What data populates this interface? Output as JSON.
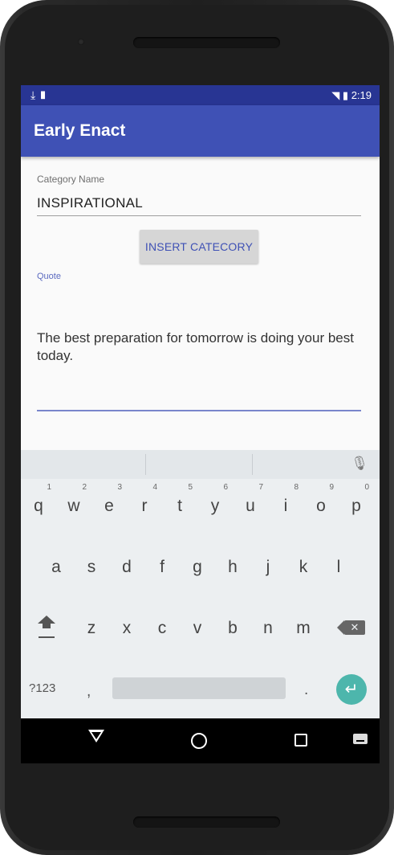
{
  "status_bar": {
    "left_icons": "⤓ ▮",
    "right_icons": "◥ ▮",
    "time": "2:19"
  },
  "app_bar": {
    "title": "Early Enact"
  },
  "form": {
    "category_label": "Category Name",
    "category_value": "INSPIRATIONAL",
    "insert_button_label": "INSERT CATECORY",
    "quote_label": "Quote",
    "quote_value": "The best preparation for tomorrow is doing your best today."
  },
  "keyboard": {
    "row1": [
      {
        "label": "q",
        "hint": "1"
      },
      {
        "label": "w",
        "hint": "2"
      },
      {
        "label": "e",
        "hint": "3"
      },
      {
        "label": "r",
        "hint": "4"
      },
      {
        "label": "t",
        "hint": "5"
      },
      {
        "label": "y",
        "hint": "6"
      },
      {
        "label": "u",
        "hint": "7"
      },
      {
        "label": "i",
        "hint": "8"
      },
      {
        "label": "o",
        "hint": "9"
      },
      {
        "label": "p",
        "hint": "0"
      }
    ],
    "row2": [
      "a",
      "s",
      "d",
      "f",
      "g",
      "h",
      "j",
      "k",
      "l"
    ],
    "row3": [
      "z",
      "x",
      "c",
      "v",
      "b",
      "n",
      "m"
    ],
    "symbols_label": "?123",
    "comma_label": ",",
    "period_label": ".",
    "enter_icon": "↵",
    "mic_icon": "🎙",
    "backspace_icon": "✕"
  },
  "colors": {
    "status_bar": "#283593",
    "app_bar": "#3f51b5",
    "accent": "#5c6bc0",
    "enter_key": "#4db6ac"
  }
}
